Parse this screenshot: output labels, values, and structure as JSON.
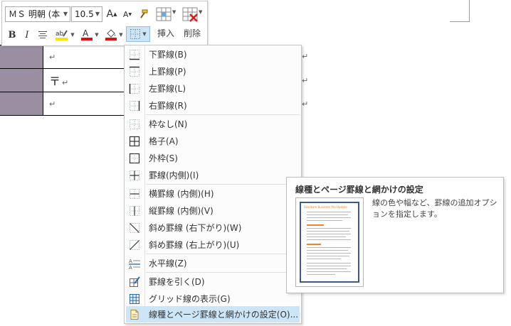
{
  "toolbar": {
    "font_name": "ＭＳ 明朝 (本",
    "font_size": "10.5",
    "grow_font": "A",
    "shrink_font": "A",
    "bold": "B",
    "italic": "I",
    "insert_label": "挿入",
    "delete_label": "削除",
    "highlight_color": "#f5e400",
    "font_color": "#e01010",
    "shading_color": "#e01010"
  },
  "document": {
    "rows": [
      {
        "mark": "↵"
      },
      {
        "glyph": "〒",
        "mark": "↵"
      },
      {
        "mark": "↵"
      }
    ],
    "row_end_mark": "↵",
    "shade_color": "#9a8ea3"
  },
  "menu": {
    "items": [
      {
        "label": "下罫線(B)",
        "icon": "border-bottom-icon"
      },
      {
        "label": "上罫線(P)",
        "icon": "border-top-icon"
      },
      {
        "label": "左罫線(L)",
        "icon": "border-left-icon"
      },
      {
        "label": "右罫線(R)",
        "icon": "border-right-icon"
      },
      {
        "label": "枠なし(N)",
        "icon": "no-border-icon"
      },
      {
        "label": "格子(A)",
        "icon": "all-borders-icon"
      },
      {
        "label": "外枠(S)",
        "icon": "outside-borders-icon"
      },
      {
        "label": "罫線(内側)(I)",
        "icon": "inside-borders-icon"
      },
      {
        "label": "横罫線 (内側)(H)",
        "icon": "inside-horizontal-icon"
      },
      {
        "label": "縦罫線 (内側)(V)",
        "icon": "inside-vertical-icon"
      },
      {
        "label": "斜め罫線 (右下がり)(W)",
        "icon": "diagonal-down-icon"
      },
      {
        "label": "斜め罫線 (右上がり)(U)",
        "icon": "diagonal-up-icon"
      },
      {
        "label": "水平線(Z)",
        "icon": "horizontal-line-icon"
      },
      {
        "label": "罫線を引く(D)",
        "icon": "draw-table-icon"
      },
      {
        "label": "グリッド線の表示(G)",
        "icon": "view-gridlines-icon"
      },
      {
        "label": "線種とページ罫線と網かけの設定(O)...",
        "icon": "borders-shading-icon"
      }
    ]
  },
  "tooltip": {
    "title": "線種とページ罫線と網かけの設定",
    "description": "線の色や幅など、罫線の追加オプションを指定します。",
    "thumb_heading": "Fabrikam Business Pro Update"
  }
}
